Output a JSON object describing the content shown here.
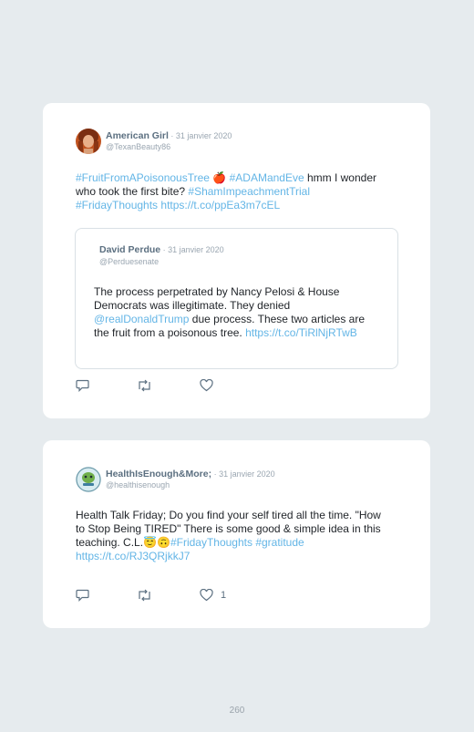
{
  "tweets": [
    {
      "author": "American Girl",
      "date_sep": " · ",
      "date": "31 janvier 2020",
      "handle": "@TexanBeauty86",
      "body": {
        "hashtag1": "#FruitFromAPoisonousTree",
        "emoji": "🍎",
        "hashtag2": "#ADAMandEve",
        "text1": " hmm I wonder who took the first bite? ",
        "hashtag3": "#ShamImpeachmentTrial",
        "hashtag4": "#FridayThoughts",
        "url": "https://t.co/ppEa3m7cEL"
      },
      "quote": {
        "author": "David Perdue",
        "date_sep": " · ",
        "date": "31 janvier 2020",
        "handle": "@Perduesenate",
        "text1": "The process perpetrated by Nancy Pelosi & House Democrats was illegitimate. They denied ",
        "mention": "@realDonaldTrump",
        "text2": " due process. These two articles are the fruit from a poisonous tree. ",
        "url": "https://t.co/TiRlNjRTwB"
      },
      "like_count": ""
    },
    {
      "author": "HealthIsEnough&More;",
      "date_sep": " · ",
      "date": "31 janvier 2020",
      "handle": "@healthisenough",
      "body": {
        "text1": "Health Talk Friday; Do you find your self tired all the time. \"How to Stop Being TIRED\" There is some good & simple idea in this teaching. C.L.",
        "emoji": "😇🙃",
        "hashtag1": "#FridayThoughts",
        "hashtag2": "#gratitude",
        "url": "https://t.co/RJ3QRjkkJ7"
      },
      "like_count": "1"
    }
  ],
  "icons": {
    "reply": "reply-icon",
    "retweet": "retweet-icon",
    "like": "heart-icon"
  },
  "colors": {
    "link": "#63b5e6",
    "author": "#5b6f80",
    "muted": "#9aa6b1",
    "background": "#e6ebee"
  },
  "page_number": "260"
}
